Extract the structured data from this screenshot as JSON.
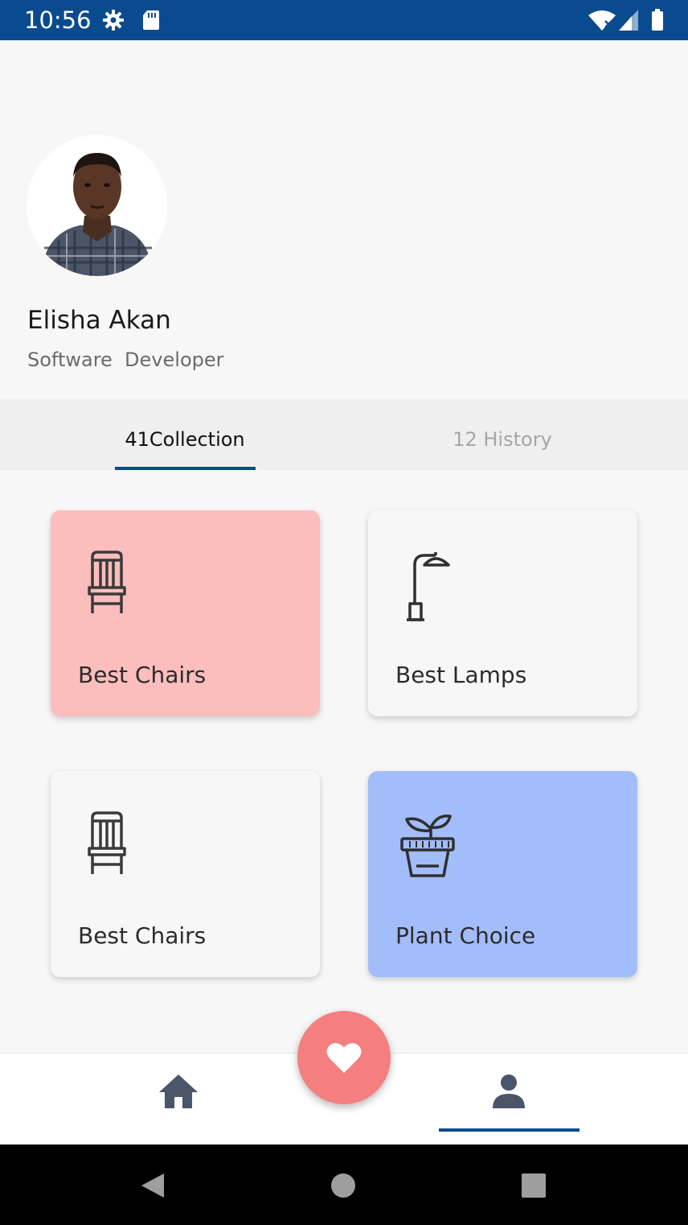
{
  "status_bar": {
    "time": "10:56",
    "background": "#0a4a8f",
    "icons": [
      "gear-icon",
      "sd-card-icon",
      "wifi-icon",
      "signal-icon",
      "battery-icon"
    ]
  },
  "profile": {
    "name": "Elisha Akan",
    "role": "Software  Developer"
  },
  "tabs": [
    {
      "label": "41Collection",
      "active": true
    },
    {
      "label": "12 History",
      "active": false
    }
  ],
  "cards": [
    {
      "label": "Best Chairs",
      "icon": "chair-icon",
      "color": "#fbbebd"
    },
    {
      "label": "Best Lamps",
      "icon": "lamp-icon",
      "color": "#f7f7f7"
    },
    {
      "label": "Best Chairs",
      "icon": "chair-icon",
      "color": "#f7f7f7"
    },
    {
      "label": "Plant Choice",
      "icon": "plant-pot-icon",
      "color": "#a2bdfa"
    }
  ],
  "fab": {
    "icon": "heart-icon",
    "color": "#f47f7e"
  },
  "bottom_nav": {
    "items": [
      {
        "icon": "home-icon",
        "active": false
      },
      {
        "icon": "person-icon",
        "active": true
      }
    ]
  },
  "system_nav": [
    "back-icon",
    "home-circle-icon",
    "recents-icon"
  ]
}
